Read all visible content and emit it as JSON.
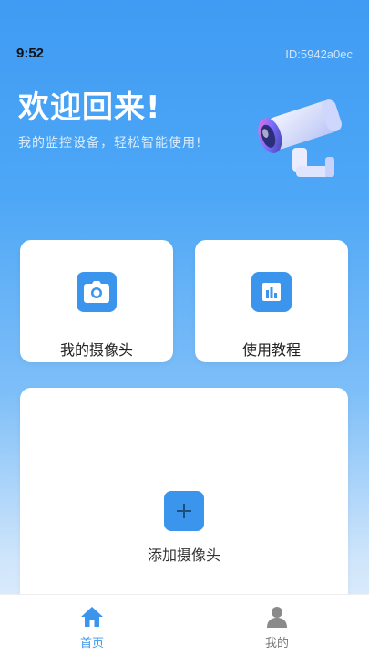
{
  "status": {
    "time": "9:52",
    "device_id": "ID:5942a0ec"
  },
  "header": {
    "title": "欢迎回来!",
    "subtitle": "我的监控设备，轻松智能使用!"
  },
  "cards": {
    "my_camera": {
      "label": "我的摄像头",
      "icon": "camera-icon"
    },
    "tutorial": {
      "label": "使用教程",
      "icon": "chart-bars-icon"
    },
    "add_camera": {
      "label": "添加摄像头",
      "icon": "plus-icon"
    }
  },
  "tabbar": {
    "home": {
      "label": "首页",
      "icon": "home-icon",
      "active": true
    },
    "mine": {
      "label": "我的",
      "icon": "person-icon",
      "active": false
    }
  },
  "colors": {
    "accent": "#3c95ec",
    "background_top": "#3f9bf3",
    "card": "#ffffff"
  }
}
